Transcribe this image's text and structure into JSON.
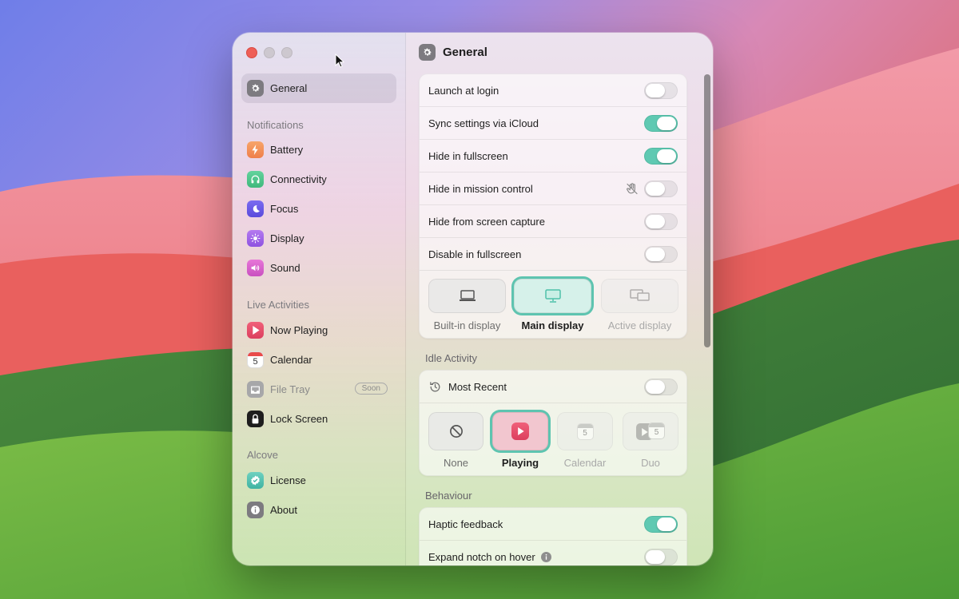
{
  "sidebar": {
    "general": "General",
    "sections": {
      "notifications": "Notifications",
      "live_activities": "Live Activities",
      "alcove": "Alcove"
    },
    "items": {
      "battery": "Battery",
      "connectivity": "Connectivity",
      "focus": "Focus",
      "display": "Display",
      "sound": "Sound",
      "now_playing": "Now Playing",
      "calendar": "Calendar",
      "calendar_day": "5",
      "file_tray": "File Tray",
      "file_tray_badge": "Soon",
      "lock_screen": "Lock Screen",
      "license": "License",
      "about": "About"
    }
  },
  "main": {
    "title": "General",
    "general_rows": [
      {
        "label": "Launch at login",
        "on": false
      },
      {
        "label": "Sync settings via iCloud",
        "on": true
      },
      {
        "label": "Hide in fullscreen",
        "on": true
      },
      {
        "label": "Hide in mission control",
        "on": false
      },
      {
        "label": "Hide from screen capture",
        "on": false
      },
      {
        "label": "Disable in fullscreen",
        "on": false
      }
    ],
    "display_options": {
      "builtin": "Built-in display",
      "main": "Main display",
      "active": "Active display",
      "selected": "Main display"
    },
    "idle_activity": {
      "heading": "Idle Activity",
      "most_recent": "Most Recent",
      "most_recent_on": false,
      "options": {
        "none": "None",
        "playing": "Playing",
        "calendar": "Calendar",
        "duo": "Duo"
      },
      "selected": "Playing",
      "calendar_day": "5"
    },
    "behaviour": {
      "heading": "Behaviour",
      "haptic": "Haptic feedback",
      "haptic_on": true,
      "expand": "Expand notch on hover",
      "expand_on": false
    }
  },
  "colors": {
    "accent": "#5fc9b2",
    "close": "#ee5f57"
  }
}
